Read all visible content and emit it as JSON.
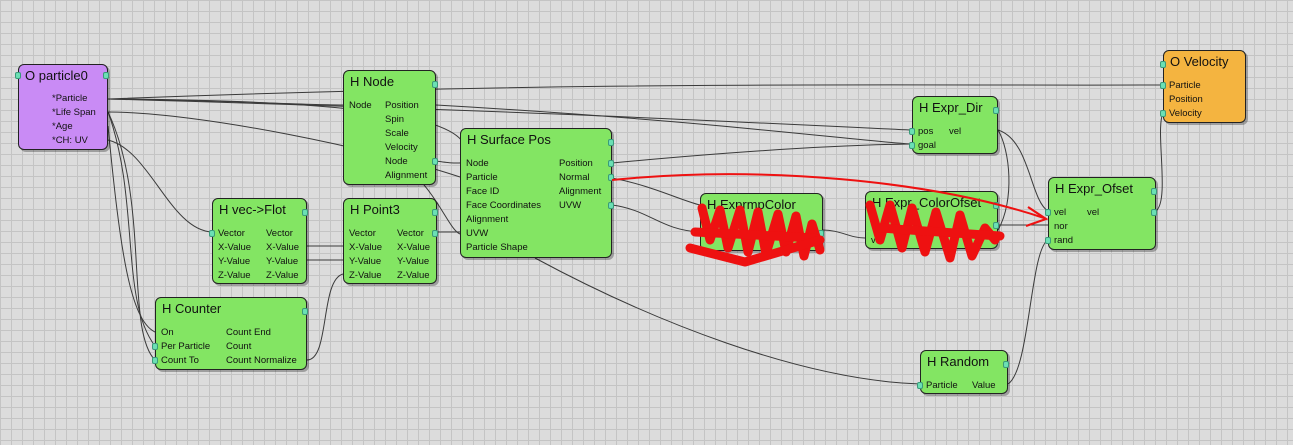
{
  "nodes": {
    "particle0": {
      "title": "O particle0",
      "outputs": [
        "*Particle",
        "*Life Span",
        "*Age",
        "*CH: UV"
      ]
    },
    "node": {
      "title": "H Node",
      "input": "Node",
      "outputs": [
        "Position",
        "Spin",
        "Scale",
        "Velocity",
        "Node",
        "Alignment"
      ]
    },
    "surface_pos": {
      "title": "H Surface Pos",
      "inputs": [
        "Node",
        "Particle",
        "Face ID",
        "Face Coordinates",
        "Alignment",
        "UVW",
        "Particle Shape"
      ],
      "outputs": [
        "Position",
        "Normal",
        "Alignment",
        "UVW"
      ]
    },
    "vec_flot": {
      "title": "H vec->Flot",
      "inputs": [
        "Vector",
        "X-Value",
        "Y-Value",
        "Z-Value"
      ],
      "outputs": [
        "Vector",
        "X-Value",
        "Y-Value",
        "Z-Value"
      ]
    },
    "point3": {
      "title": "H Point3",
      "inputs": [
        "Vector",
        "X-Value",
        "Y-Value",
        "Z-Value"
      ],
      "outputs": [
        "Vector",
        "X-Value",
        "Y-Value",
        "Z-Value"
      ]
    },
    "counter": {
      "title": "H Counter",
      "inputs": [
        "On",
        "Per Particle",
        "Count To"
      ],
      "outputs": [
        "Count End",
        "Count",
        "Count Normalize"
      ]
    },
    "expr_dir": {
      "title": "H Expr_Dir",
      "inputs": [
        "pos",
        "goal"
      ],
      "output": "vel"
    },
    "velocity": {
      "title": "O Velocity",
      "inputs": [
        "Particle",
        "Position",
        "Velocity"
      ]
    },
    "expr_color": {
      "title": "H ExprmpColor",
      "partial": "Po"
    },
    "color_ofset": {
      "title": "H Expr_ColorOfset",
      "inputs": [
        "vel",
        "vel"
      ]
    },
    "expr_ofset": {
      "title": "H Expr_Ofset",
      "inputs": [
        "vel",
        "nor",
        "rand"
      ],
      "output": "vel"
    },
    "random": {
      "title": "H Random",
      "input": "Particle",
      "output": "Value"
    }
  },
  "colors": {
    "operator_purple": "#c98bf5",
    "helper_green": "#83e563",
    "output_orange": "#f4b440",
    "port_teal": "#6be0b4",
    "wire": "#3a3a3a",
    "annotation_red": "#ee1111"
  },
  "annotations": {
    "arrow": "red-arrow-icon",
    "scribbles": "red-scribble-icon"
  }
}
